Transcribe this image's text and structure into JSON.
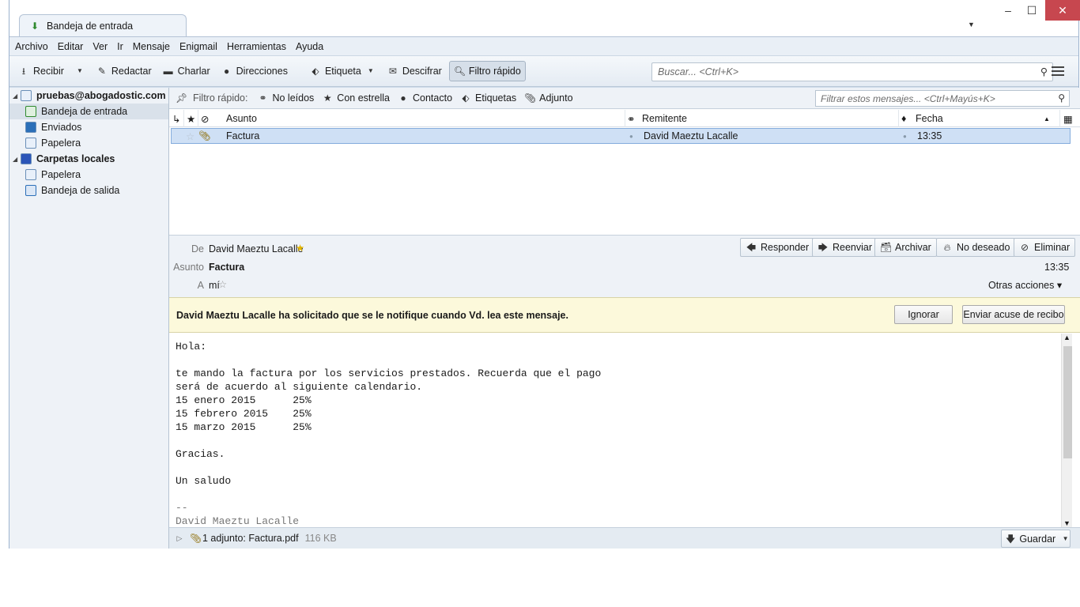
{
  "window": {
    "tab_title": "Bandeja de entrada",
    "controls": {
      "minimize": "–",
      "maximize": "☐",
      "close": "✕"
    }
  },
  "menu": [
    "Archivo",
    "Editar",
    "Ver",
    "Ir",
    "Mensaje",
    "Enigmail",
    "Herramientas",
    "Ayuda"
  ],
  "toolbar": {
    "get_mail": "Recibir",
    "write": "Redactar",
    "chat": "Charlar",
    "address_book": "Direcciones",
    "tag": "Etiqueta",
    "decrypt": "Descifrar",
    "quick_filter": "Filtro rápido",
    "search_placeholder": "Buscar... <Ctrl+K>"
  },
  "folders": {
    "account": "pruebas@abogadostic.com",
    "inbox": "Bandeja de entrada",
    "sent": "Enviados",
    "trash": "Papelera",
    "local": "Carpetas locales",
    "local_trash": "Papelera",
    "outbox": "Bandeja de salida"
  },
  "quickfilter": {
    "label": "Filtro rápido:",
    "unread": "No leídos",
    "starred": "Con estrella",
    "contact": "Contacto",
    "tags": "Etiquetas",
    "attachment": "Adjunto",
    "placeholder": "Filtrar estos mensajes... <Ctrl+Mayús+K>"
  },
  "columns": {
    "subject": "Asunto",
    "sender": "Remitente",
    "date": "Fecha"
  },
  "messages": [
    {
      "subject": "Factura",
      "sender": "David Maeztu Lacalle",
      "date": "13:35"
    }
  ],
  "header": {
    "from_label": "De",
    "from": "David Maeztu Lacalle",
    "subject_label": "Asunto",
    "subject": "Factura",
    "to_label": "A",
    "to": "mí",
    "time": "13:35",
    "other_actions": "Otras acciones ▾",
    "reply": "Responder",
    "forward": "Reenviar",
    "archive": "Archivar",
    "junk": "No deseado",
    "delete": "Eliminar"
  },
  "notification": {
    "text": "David Maeztu Lacalle ha solicitado que se le notifique cuando Vd. lea este mensaje.",
    "ignore": "Ignorar",
    "send_receipt": "Enviar acuse de recibo"
  },
  "body": {
    "lines": [
      "Hola:",
      "",
      "te mando la factura por los servicios prestados. Recuerda que el pago",
      "será de acuerdo al siguiente calendario.",
      "15 enero 2015      25%",
      "15 febrero 2015    25%",
      "15 marzo 2015      25%",
      "",
      "Gracias.",
      "",
      "Un saludo",
      ""
    ],
    "sig_sep": "--",
    "sig_name": "David Maeztu Lacalle"
  },
  "attachment": {
    "label": "1 adjunto: Factura.pdf",
    "size": "116 KB",
    "save": "Guardar"
  }
}
